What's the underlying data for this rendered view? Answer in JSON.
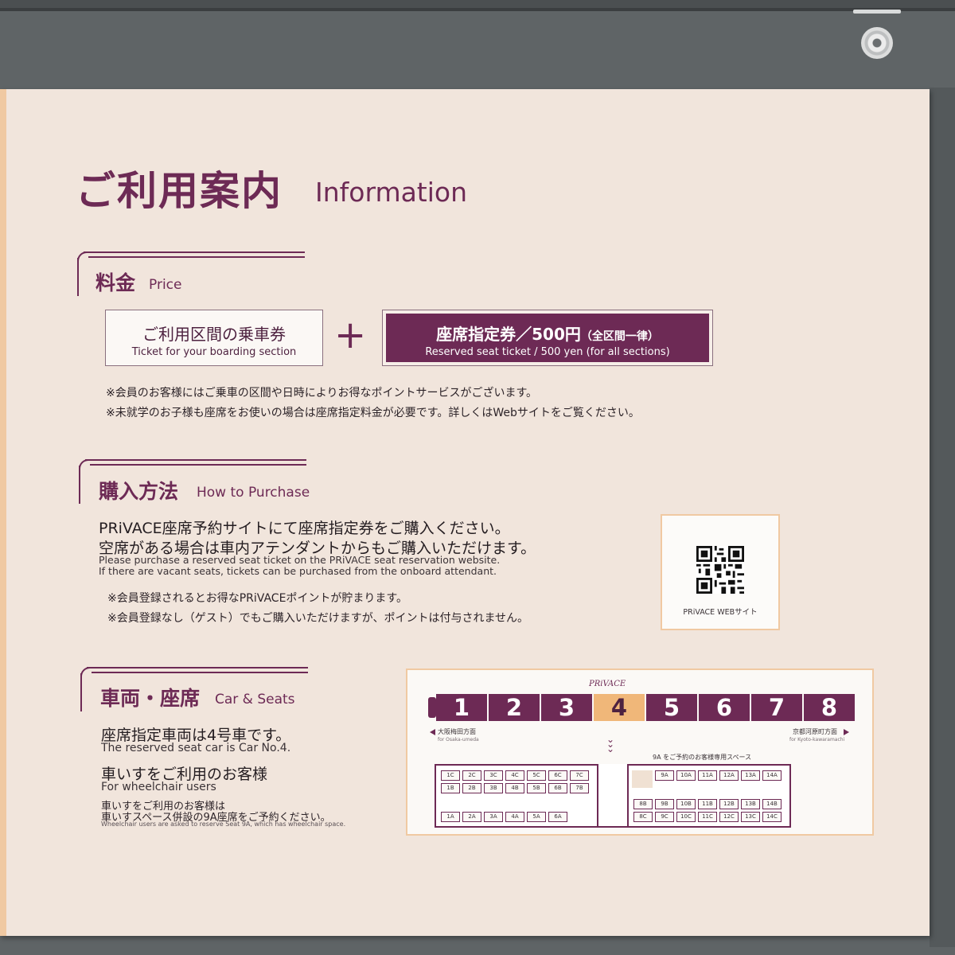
{
  "title": {
    "jp": "ご利用案内",
    "en": "Information"
  },
  "price": {
    "title_jp": "料金",
    "title_en": "Price",
    "box1_jp": "ご利用区間の乗車券",
    "box1_en": "Ticket for your boarding section",
    "plus": "+",
    "box2_jp": "座席指定券／500円",
    "box2_jp_small": "（全区間一律）",
    "box2_en": "Reserved seat ticket / 500 yen (for all sections)",
    "notes": [
      "※会員のお客様にはご乗車の区間や日時によりお得なポイントサービスがございます。",
      "※未就学のお子様も座席をお使いの場合は座席指定料金が必要です。詳しくはWebサイトをご覧ください。"
    ]
  },
  "purchase": {
    "title_jp": "購入方法",
    "title_en": "How to Purchase",
    "body_jp": [
      "PRiVACE座席予約サイトにて座席指定券をご購入ください。",
      "空席がある場合は車内アテンダントからもご購入いただけます。"
    ],
    "body_en": [
      "Please purchase a reserved seat ticket on the PRiVACE seat reservation website.",
      "If there are vacant seats, tickets can be purchased from the onboard attendant."
    ],
    "notes": [
      "※会員登録されるとお得なPRiVACEポイントが貯まります。",
      "※会員登録なし（ゲスト）でもご購入いただけますが、ポイントは付与されません。"
    ],
    "qr_label": "PRiVACE WEBサイト"
  },
  "seats": {
    "title_jp": "車両・座席",
    "title_en": "Car & Seats",
    "reserved_jp": "座席指定車両は4号車です。",
    "reserved_en": "The reserved seat car is Car No.4.",
    "wheel_jp": "車いすをご利用のお客様",
    "wheel_en": "For wheelchair users",
    "wheel_body_jp": [
      "車いすをご利用のお客様は",
      "車いすスペース併設の9A座席をご予約ください。"
    ],
    "wheel_body_en": "Wheelchair users are asked to reserve Seat 9A, which has wheelchair space."
  },
  "map": {
    "logo": "PRiVACE",
    "cars": [
      "1",
      "2",
      "3",
      "4",
      "5",
      "6",
      "7",
      "8"
    ],
    "highlight_car": "4",
    "left_dir": "大阪梅田方面",
    "left_dir_en": "for Osaka-umeda",
    "right_dir": "京都河原町方面",
    "right_dir_en": "for Kyoto-kawaramachi",
    "ws_note": "9A をご予約のお客様専用スペース",
    "left_rows": [
      [
        "1C",
        "2C",
        "3C",
        "4C",
        "5C",
        "6C",
        "7C"
      ],
      [
        "1B",
        "2B",
        "3B",
        "4B",
        "5B",
        "6B",
        "7B"
      ],
      [
        "1A",
        "2A",
        "3A",
        "4A",
        "5A",
        "6A"
      ]
    ],
    "right_rows": [
      [
        "9A",
        "10A",
        "11A",
        "12A",
        "13A",
        "14A"
      ],
      [
        "8B",
        "9B",
        "10B",
        "11B",
        "12B",
        "13B",
        "14B"
      ],
      [
        "8C",
        "9C",
        "10C",
        "11C",
        "12C",
        "13C",
        "14C"
      ]
    ]
  },
  "colors": {
    "brand": "#6d2a55",
    "accent": "#f0b779",
    "panel": "#f1e5dc"
  }
}
